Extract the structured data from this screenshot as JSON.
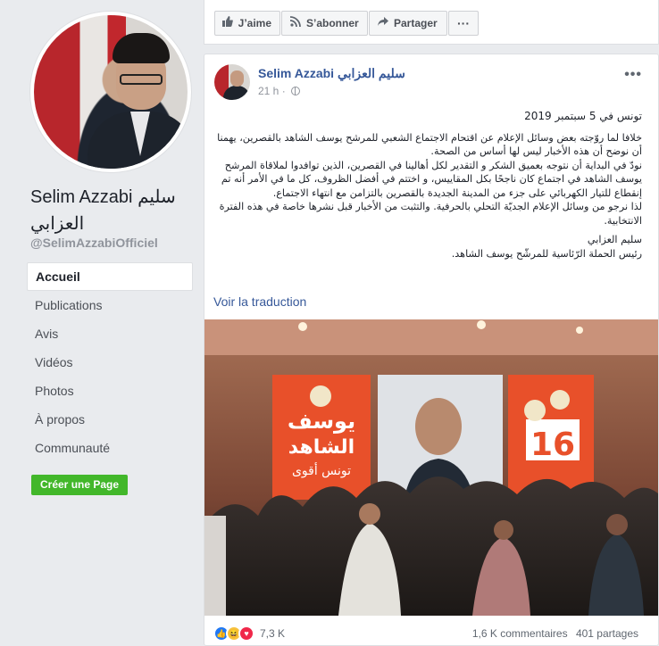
{
  "page": {
    "name": "Selim Azzabi سليم العزابي",
    "handle": "@SelimAzzabiOfficiel",
    "nav": [
      "Accueil",
      "Publications",
      "Avis",
      "Vidéos",
      "Photos",
      "À propos",
      "Communauté"
    ],
    "active_nav": "Accueil",
    "create_page_label": "Créer une Page"
  },
  "toolbar": {
    "like": "J’aime",
    "subscribe": "S’abonner",
    "share": "Partager",
    "more": "···"
  },
  "post": {
    "author": "Selim Azzabi سليم العزابي",
    "time": "21 h ·",
    "date_line": "تونس في 5 سبتمبر 2019",
    "paragraph1": "خلافا لما روّجته بعض وسائل الإعلام عن اقتحام الاجتماع الشعبي للمرشح يوسف الشاهد بالقصرين، يهمنا أن نوضح أن هذه الأخبار ليس لها أساس من الصحة.",
    "paragraph2": "نودّ في البداية أن نتوجه بعميق الشكر و التقدير لكل أهالينا في القصرين، الذين توافدوا لملاقاة المرشح يوسف الشاهد في اجتماع كان ناجحًا بكل المقاييس، و اختتم في أفضل الظروف، كل ما في الأمر أنه تم إنقطاع للتيار الكهربائي على جزء من المدينة الجديدة بالقصرين بالتزامن مع انتهاء الاجتماع.",
    "paragraph3": "لذا نرجو من وسائل الإعلام الجديّة التحلي بالحرفية. والتثبت من الأخبار قبل نشرها خاصة في هذه الفترة الانتخابية.",
    "signature_name": "سليم العزابي",
    "signature_title": "رئيس الحملة الرّئاسية للمرشّح يوسف الشاهد.",
    "translate_link": "Voir la traduction",
    "photo": {
      "banner_line1": "يوسف",
      "banner_line2": "الشاهد",
      "banner_line3": "تونس أقوى",
      "number": "16"
    },
    "reaction_count": "7,3 K",
    "comments": "1,6 K commentaires",
    "shares": "401 partages"
  },
  "colors": {
    "link": "#365899",
    "create_button": "#42b72a",
    "banner": "#e8502a"
  },
  "icons": {
    "like": "thumbs-up-icon",
    "subscribe": "rss-icon",
    "share": "share-arrow-icon",
    "globe": "globe-icon"
  }
}
